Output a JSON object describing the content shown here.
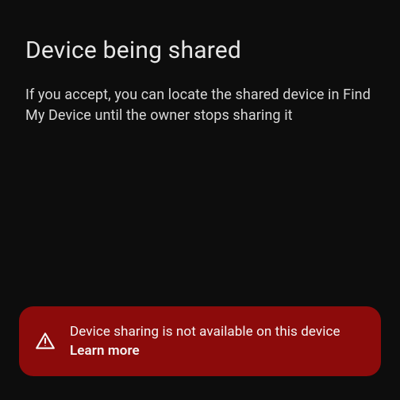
{
  "header": {
    "title": "Device being shared",
    "description": "If you accept, you can locate the shared device in Find My Device until the owner stops sharing it"
  },
  "error_banner": {
    "message": "Device sharing is not available on this device",
    "learn_more_label": "Learn more"
  },
  "colors": {
    "background": "#0d0d0d",
    "text_primary": "#e6e6e6",
    "text_secondary": "#d8d8d8",
    "error_background": "#8c0b0b",
    "error_text": "#f5f5f5"
  }
}
